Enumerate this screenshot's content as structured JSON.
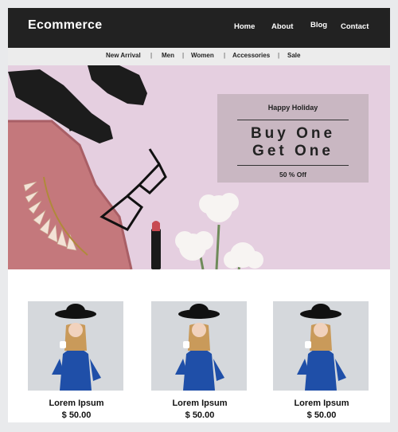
{
  "header": {
    "brand": "Ecommerce",
    "nav": [
      "Home",
      "About",
      "Blog",
      "Contact"
    ]
  },
  "categories": [
    "New Arrival",
    "Men",
    "Women",
    "Accessories",
    "Sale"
  ],
  "hero": {
    "eyebrow": "Happy Holiday",
    "headline_line1": "Buy One",
    "headline_line2": "Get One",
    "discount": "50 % Off"
  },
  "products": [
    {
      "name": "Lorem Ipsum",
      "price": "$ 50.00"
    },
    {
      "name": "Lorem Ipsum",
      "price": "$ 50.00"
    },
    {
      "name": "Lorem Ipsum",
      "price": "$ 50.00"
    }
  ],
  "colors": {
    "header_bg": "#222222",
    "category_bar_bg": "#ececec",
    "hero_bg": "#e5cfe0",
    "promo_box": "#c9b7c2",
    "dress_blue": "#1f4fa8"
  }
}
